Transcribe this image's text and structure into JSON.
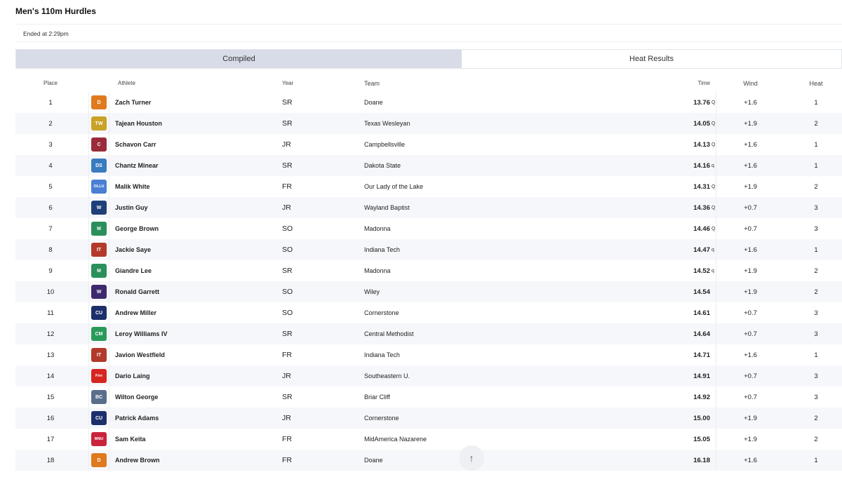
{
  "event": {
    "title": "Men's 110m Hurdles",
    "status": "Ended at 2:29pm"
  },
  "tabs": [
    {
      "label": "Compiled",
      "active": true
    },
    {
      "label": "Heat Results",
      "active": false
    }
  ],
  "table": {
    "headers": {
      "place": "Place",
      "athlete": "Athlete",
      "year": "Year",
      "team": "Team",
      "time": "Time",
      "wind": "Wind",
      "heat": "Heat"
    },
    "rows": [
      {
        "place": "1",
        "athlete": "Zach Turner",
        "year": "SR",
        "team": "Doane",
        "time": "13.76",
        "q": "Q",
        "wind": "+1.6",
        "heat": "1",
        "logo_icon": "doane-logo-icon",
        "logo_color": "#e07a1f",
        "logo_text": "D"
      },
      {
        "place": "2",
        "athlete": "Tajean Houston",
        "year": "SR",
        "team": "Texas Wesleyan",
        "time": "14.05",
        "q": "Q",
        "wind": "+1.9",
        "heat": "2",
        "logo_icon": "texas-wesleyan-logo-icon",
        "logo_color": "#c9a227",
        "logo_text": "TW"
      },
      {
        "place": "3",
        "athlete": "Schavon Carr",
        "year": "JR",
        "team": "Campbellsville",
        "time": "14.13",
        "q": "Q",
        "wind": "+1.6",
        "heat": "1",
        "logo_icon": "campbellsville-logo-icon",
        "logo_color": "#9b2b3a",
        "logo_text": "C"
      },
      {
        "place": "4",
        "athlete": "Chantz Minear",
        "year": "SR",
        "team": "Dakota State",
        "time": "14.16",
        "q": "q",
        "wind": "+1.6",
        "heat": "1",
        "logo_icon": "dakota-state-logo-icon",
        "logo_color": "#3a7bbf",
        "logo_text": "DS"
      },
      {
        "place": "5",
        "athlete": "Malik White",
        "year": "FR",
        "team": "Our Lady of the Lake",
        "time": "14.31",
        "q": "Q",
        "wind": "+1.9",
        "heat": "2",
        "logo_icon": "ollu-logo-icon",
        "logo_color": "#4a7fd4",
        "logo_text": "OLLU"
      },
      {
        "place": "6",
        "athlete": "Justin Guy",
        "year": "JR",
        "team": "Wayland Baptist",
        "time": "14.36",
        "q": "Q",
        "wind": "+0.7",
        "heat": "3",
        "logo_icon": "wayland-baptist-logo-icon",
        "logo_color": "#1f3f7a",
        "logo_text": "W"
      },
      {
        "place": "7",
        "athlete": "George Brown",
        "year": "SO",
        "team": "Madonna",
        "time": "14.46",
        "q": "Q",
        "wind": "+0.7",
        "heat": "3",
        "logo_icon": "madonna-logo-icon",
        "logo_color": "#2a8f5b",
        "logo_text": "M"
      },
      {
        "place": "8",
        "athlete": "Jackie Saye",
        "year": "SO",
        "team": "Indiana Tech",
        "time": "14.47",
        "q": "q",
        "wind": "+1.6",
        "heat": "1",
        "logo_icon": "indiana-tech-logo-icon",
        "logo_color": "#b23a2a",
        "logo_text": "IT"
      },
      {
        "place": "9",
        "athlete": "Giandre Lee",
        "year": "SR",
        "team": "Madonna",
        "time": "14.52",
        "q": "q",
        "wind": "+1.9",
        "heat": "2",
        "logo_icon": "madonna-logo-icon",
        "logo_color": "#2a8f5b",
        "logo_text": "M"
      },
      {
        "place": "10",
        "athlete": "Ronald Garrett",
        "year": "SO",
        "team": "Wiley",
        "time": "14.54",
        "q": "",
        "wind": "+1.9",
        "heat": "2",
        "logo_icon": "wiley-logo-icon",
        "logo_color": "#3d2a6e",
        "logo_text": "W"
      },
      {
        "place": "11",
        "athlete": "Andrew Miller",
        "year": "SO",
        "team": "Cornerstone",
        "time": "14.61",
        "q": "",
        "wind": "+0.7",
        "heat": "3",
        "logo_icon": "cornerstone-logo-icon",
        "logo_color": "#1d2f6b",
        "logo_text": "CU"
      },
      {
        "place": "12",
        "athlete": "Leroy Williams IV",
        "year": "SR",
        "team": "Central Methodist",
        "time": "14.64",
        "q": "",
        "wind": "+0.7",
        "heat": "3",
        "logo_icon": "central-methodist-logo-icon",
        "logo_color": "#2a9a5a",
        "logo_text": "CM"
      },
      {
        "place": "13",
        "athlete": "Javion Westfield",
        "year": "FR",
        "team": "Indiana Tech",
        "time": "14.71",
        "q": "",
        "wind": "+1.6",
        "heat": "1",
        "logo_icon": "indiana-tech-logo-icon",
        "logo_color": "#b23a2a",
        "logo_text": "IT"
      },
      {
        "place": "14",
        "athlete": "Dario Laing",
        "year": "JR",
        "team": "Southeastern U.",
        "time": "14.91",
        "q": "",
        "wind": "+0.7",
        "heat": "3",
        "logo_icon": "southeastern-fire-logo-icon",
        "logo_color": "#d6261f",
        "logo_text": "Fire"
      },
      {
        "place": "15",
        "athlete": "Wilton George",
        "year": "SR",
        "team": "Briar Cliff",
        "time": "14.92",
        "q": "",
        "wind": "+0.7",
        "heat": "3",
        "logo_icon": "briar-cliff-logo-icon",
        "logo_color": "#5a6e8c",
        "logo_text": "BC"
      },
      {
        "place": "16",
        "athlete": "Patrick Adams",
        "year": "JR",
        "team": "Cornerstone",
        "time": "15.00",
        "q": "",
        "wind": "+1.9",
        "heat": "2",
        "logo_icon": "cornerstone-logo-icon",
        "logo_color": "#1d2f6b",
        "logo_text": "CU"
      },
      {
        "place": "17",
        "athlete": "Sam Keita",
        "year": "FR",
        "team": "MidAmerica Nazarene",
        "time": "15.05",
        "q": "",
        "wind": "+1.9",
        "heat": "2",
        "logo_icon": "midamerica-nazarene-logo-icon",
        "logo_color": "#c8243b",
        "logo_text": "MNU"
      },
      {
        "place": "18",
        "athlete": "Andrew Brown",
        "year": "FR",
        "team": "Doane",
        "time": "16.18",
        "q": "",
        "wind": "+1.6",
        "heat": "1",
        "logo_icon": "doane-logo-icon",
        "logo_color": "#e07a1f",
        "logo_text": "D"
      }
    ]
  },
  "scroll_top": {
    "icon": "arrow-up-icon",
    "glyph": "↑"
  }
}
